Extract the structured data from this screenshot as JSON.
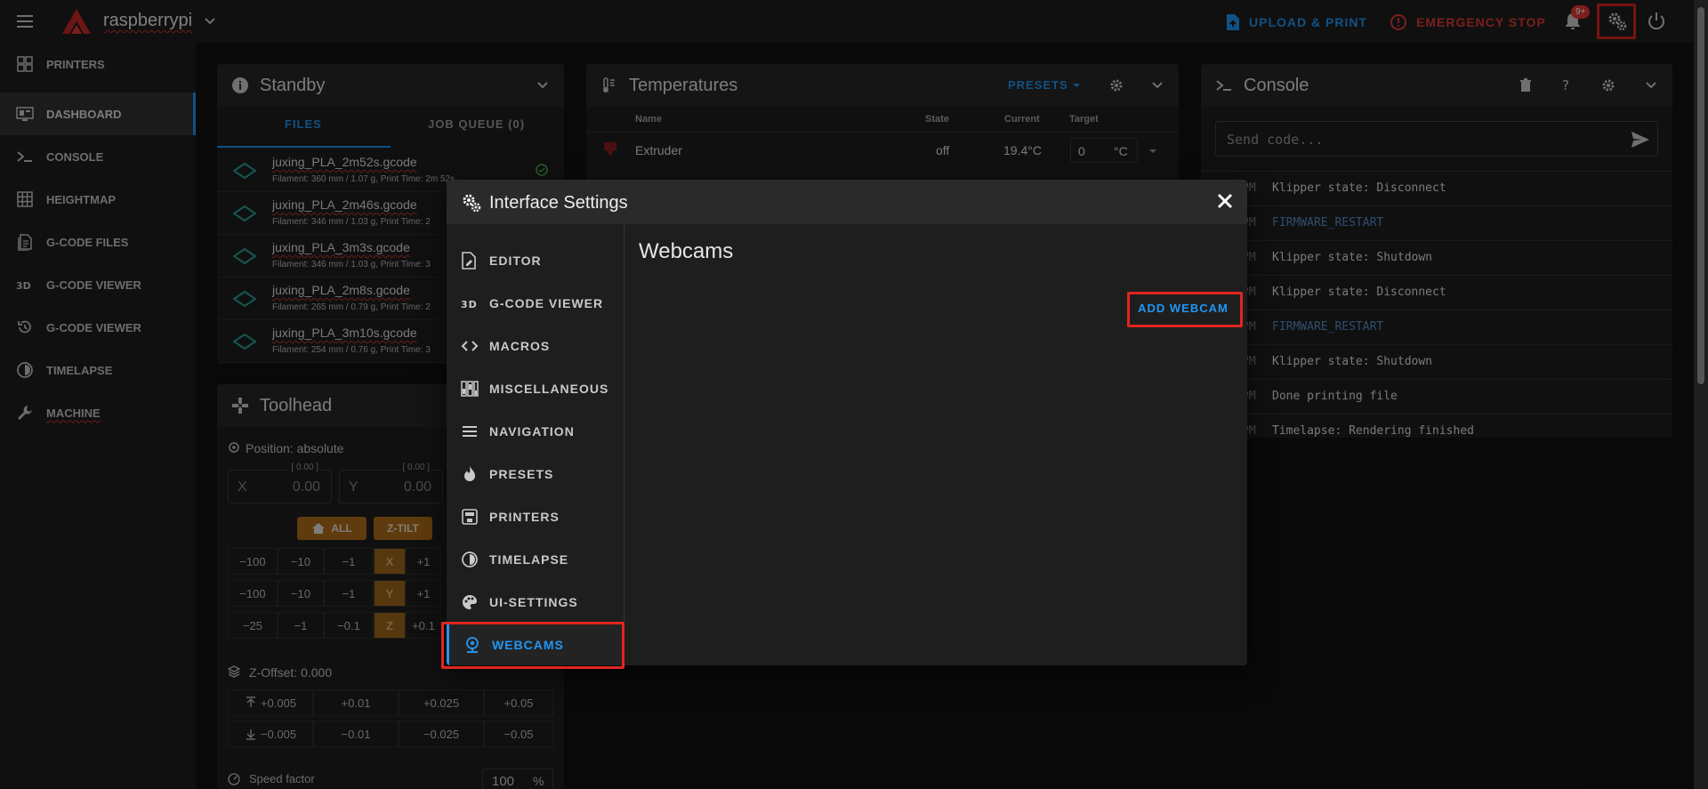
{
  "topbar": {
    "host": "raspberrypi",
    "upload_label": "UPLOAD & PRINT",
    "estop_label": "EMERGENCY STOP",
    "notification_count": "9+"
  },
  "sidebar": {
    "items": [
      {
        "label": "PRINTERS",
        "icon": "printers-icon"
      },
      {
        "label": "DASHBOARD",
        "icon": "dashboard-icon"
      },
      {
        "label": "CONSOLE",
        "icon": "console-icon"
      },
      {
        "label": "HEIGHTMAP",
        "icon": "heightmap-icon"
      },
      {
        "label": "G-CODE FILES",
        "icon": "gcode-files-icon"
      },
      {
        "label": "G-CODE VIEWER",
        "icon": "3d-icon"
      },
      {
        "label": "G-CODE VIEWER",
        "icon": "history-icon"
      },
      {
        "label": "TIMELAPSE",
        "icon": "timelapse-icon"
      },
      {
        "label": "MACHINE",
        "icon": "wrench-icon"
      }
    ]
  },
  "standby": {
    "title": "Standby",
    "tabs": [
      "FILES",
      "JOB QUEUE (0)"
    ],
    "files": [
      {
        "name": "juxing_PLA_2m52s.gcode",
        "meta": "Filament: 360 mm / 1.07 g, Print Time: 2m 52s"
      },
      {
        "name": "juxing_PLA_2m46s.gcode",
        "meta": "Filament: 346 mm / 1.03 g, Print Time: 2"
      },
      {
        "name": "juxing_PLA_3m3s.gcode",
        "meta": "Filament: 346 mm / 1.03 g, Print Time: 3"
      },
      {
        "name": "juxing_PLA_2m8s.gcode",
        "meta": "Filament: 265 mm / 0.79 g, Print Time: 2"
      },
      {
        "name": "juxing_PLA_3m10s.gcode",
        "meta": "Filament: 254 mm / 0.76 g, Print Time: 3"
      }
    ]
  },
  "temperatures": {
    "title": "Temperatures",
    "presets_label": "PRESETS",
    "headers": {
      "name": "Name",
      "state": "State",
      "current": "Current",
      "target": "Target"
    },
    "rows": [
      {
        "name": "Extruder",
        "state": "off",
        "current": "19.4°C",
        "target": "0",
        "unit": "°C"
      }
    ]
  },
  "console": {
    "title": "Console",
    "input_placeholder": "Send code...",
    "lines": [
      {
        "time": "PM",
        "text": "Klipper state: Disconnect",
        "kind": "msg"
      },
      {
        "time": "PM",
        "text": "FIRMWARE_RESTART",
        "kind": "cmd"
      },
      {
        "time": "PM",
        "text": "Klipper state: Shutdown",
        "kind": "msg"
      },
      {
        "time": "PM",
        "text": "Klipper state: Disconnect",
        "kind": "msg"
      },
      {
        "time": "PM",
        "text": "FIRMWARE_RESTART",
        "kind": "cmd"
      },
      {
        "time": "PM",
        "text": "Klipper state: Shutdown",
        "kind": "msg"
      },
      {
        "time": "PM",
        "text": "Done printing file",
        "kind": "msg"
      },
      {
        "time": "PM",
        "text": "Timelapse: Rendering finished",
        "kind": "msg"
      }
    ]
  },
  "toolhead": {
    "title": "Toolhead",
    "position_label": "Position: absolute",
    "x": {
      "label": "X",
      "value": "0.00",
      "hint": "[ 0.00 ]"
    },
    "y": {
      "label": "Y",
      "value": "0.00",
      "hint": "[ 0.00 ]"
    },
    "home_all": "ALL",
    "ztilt": "Z-TILT",
    "jog_x": [
      "−100",
      "−10",
      "−1",
      "X",
      "+1"
    ],
    "jog_y": [
      "−100",
      "−10",
      "−1",
      "Y",
      "+1"
    ],
    "jog_z": [
      "−25",
      "−1",
      "−0.1",
      "Z",
      "+0.1"
    ],
    "zoffset_label": "Z-Offset: 0.000",
    "zoffset_up": [
      "+0.005",
      "+0.01",
      "+0.025",
      "+0.05"
    ],
    "zoffset_down": [
      "−0.005",
      "−0.01",
      "−0.025",
      "−0.05"
    ],
    "speed_label": "Speed factor",
    "speed_value": "100",
    "speed_unit": "%"
  },
  "dialog": {
    "title": "Interface Settings",
    "nav": [
      {
        "label": "EDITOR",
        "icon": "editor-icon"
      },
      {
        "label": "G-CODE VIEWER",
        "icon": "3d-icon"
      },
      {
        "label": "MACROS",
        "icon": "code-icon"
      },
      {
        "label": "MISCELLANEOUS",
        "icon": "sliders-icon"
      },
      {
        "label": "NAVIGATION",
        "icon": "menu-icon"
      },
      {
        "label": "PRESETS",
        "icon": "fire-icon"
      },
      {
        "label": "PRINTERS",
        "icon": "printer-icon"
      },
      {
        "label": "TIMELAPSE",
        "icon": "timelapse-icon"
      },
      {
        "label": "UI-SETTINGS",
        "icon": "palette-icon"
      },
      {
        "label": "WEBCAMS",
        "icon": "webcam-icon"
      }
    ],
    "section_title": "Webcams",
    "add_webcam_label": "ADD WEBCAM"
  },
  "colors": {
    "accent": "#2196f3",
    "danger": "#e53935",
    "orange": "#b06e18",
    "highlight": "#e0261f"
  }
}
